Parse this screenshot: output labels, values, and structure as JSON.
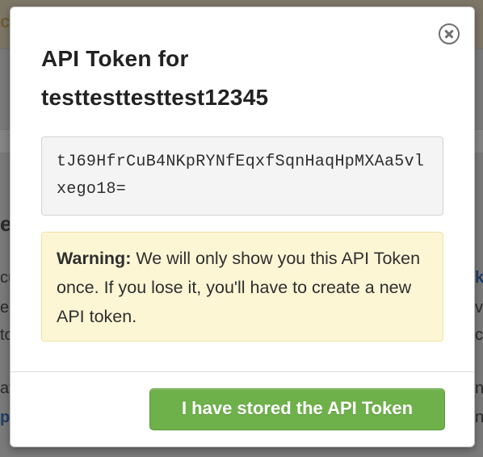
{
  "modal": {
    "title": "API Token for testtesttesttest12345",
    "token": "tJ69HfrCuB4NKpRYNfEqxfSqnHaqHpMXAa5vlxego18=",
    "warning_label": "Warning:",
    "warning_text": " We will only show you this API Token once. If you lose it, you'll have to create a new API token.",
    "confirm_label": "I have stored the API Token",
    "close_icon": "close-circle-icon",
    "colors": {
      "confirm_button": "#6eb04a",
      "warning_background": "#fdf6d5",
      "token_background": "#f4f4f4"
    }
  }
}
